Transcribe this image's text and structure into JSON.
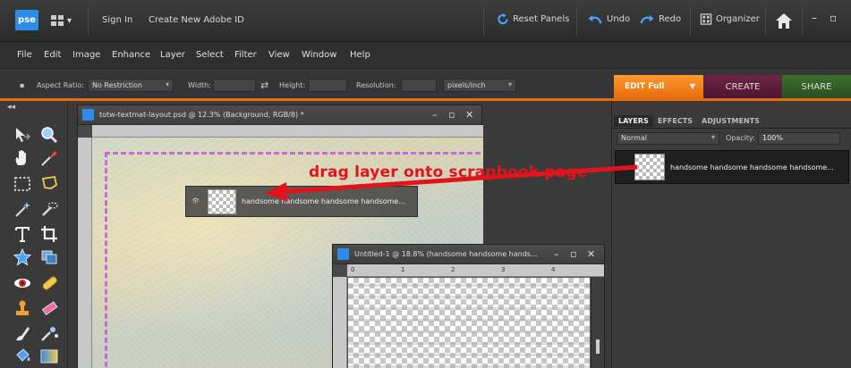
{
  "titlebar": {
    "logo": "pse",
    "sign_in": "Sign In",
    "create_id": "Create New Adobe ID",
    "reset_panels": "Reset Panels",
    "undo": "Undo",
    "redo": "Redo",
    "organizer": "Organizer",
    "minimize": "–",
    "restore": "▫"
  },
  "menu": [
    "File",
    "Edit",
    "Image",
    "Enhance",
    "Layer",
    "Select",
    "Filter",
    "View",
    "Window",
    "Help"
  ],
  "options": {
    "aspect_label": "Aspect Ratio:",
    "aspect_value": "No Restriction",
    "width_label": "Width:",
    "height_label": "Height:",
    "resolution_label": "Resolution:",
    "units_value": "pixels/inch"
  },
  "modes": {
    "edit": "EDIT Full",
    "create": "CREATE",
    "share": "SHARE"
  },
  "toolbox": {
    "collapse": "◂◂"
  },
  "doc1": {
    "title": "totw-textmat-layout.psd @ 12.3% (Background, RGB/8) *",
    "min": "–",
    "max": "▫",
    "close": "✕"
  },
  "doc2": {
    "title": "Untitled-1 @ 18.8% (handsome handsome hands...",
    "min": "–",
    "max": "▫",
    "close": "✕",
    "ruler_marks": [
      "0",
      "1",
      "2",
      "3",
      "4"
    ]
  },
  "ghost": {
    "eye": "👁",
    "name": "handsome handsome handsome handsome..."
  },
  "layers_panel": {
    "tabs": [
      "LAYERS",
      "EFFECTS",
      "ADJUSTMENTS"
    ],
    "blend_mode": "Normal",
    "opacity_label": "Opacity:",
    "opacity_value": "100%",
    "layer_name": "handsome handsome handsome handsome..."
  },
  "annotation": {
    "text": "drag layer onto scrapbook page",
    "color": "#e0141a"
  },
  "colors": {
    "accent_orange": "#e66d0a",
    "create_tab": "#6e2446",
    "share_tab": "#3d6e2e",
    "pse_blue": "#2e8be6"
  }
}
